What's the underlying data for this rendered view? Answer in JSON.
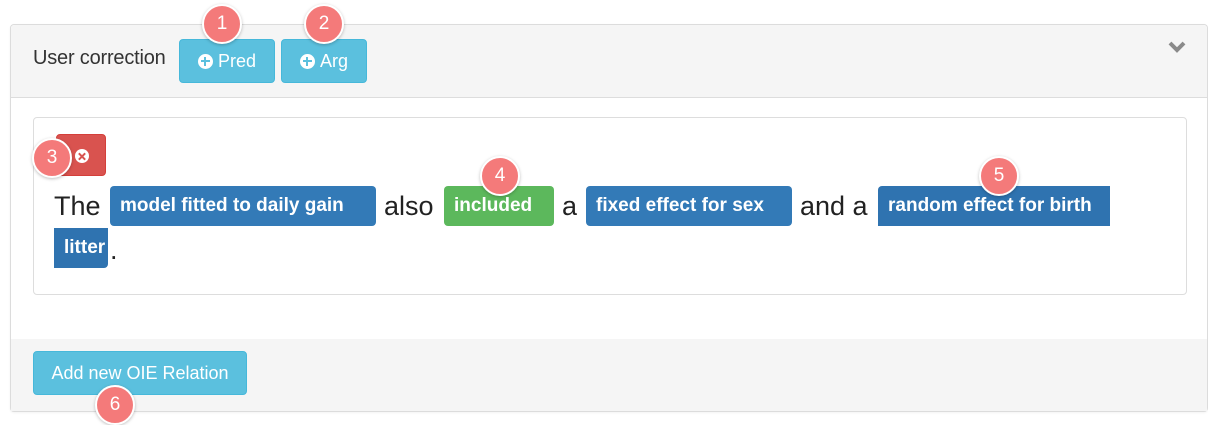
{
  "header": {
    "title": "User correction",
    "pred_button_label": "Pred",
    "arg_button_label": "Arg"
  },
  "sentence": {
    "words": {
      "the": "The",
      "also": "also",
      "a1": "a",
      "and_a": "and a",
      "period": "."
    },
    "tags": {
      "arg1": "model fitted to daily gain",
      "pred": "included",
      "arg2": "fixed effect for sex",
      "arg3_line1": "random effect for birth",
      "arg3_line2": "litter"
    }
  },
  "footer": {
    "add_button_label": "Add new OIE Relation"
  },
  "badges": [
    "1",
    "2",
    "3",
    "4",
    "5",
    "6"
  ],
  "colors": {
    "info": "#5bc0de",
    "danger": "#d9534f",
    "argument": "#337ab7",
    "predicate": "#5cb85c",
    "badge": "#f47a7a"
  },
  "icons": {
    "pred_button": "plus-circle-icon",
    "arg_button": "plus-circle-icon",
    "delete_button": "remove-circle-icon",
    "collapse": "chevron-down-icon"
  }
}
